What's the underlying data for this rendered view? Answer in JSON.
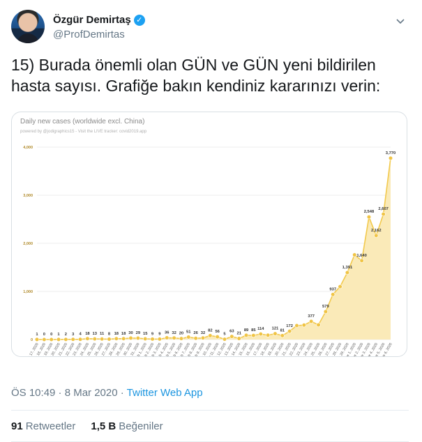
{
  "author": {
    "name": "Özgür Demirtaş",
    "handle": "@ProfDemirtas",
    "verified": true
  },
  "tweet_text": "15) Burada önemli olan GÜN ve GÜN yeni bildirilen hasta sayısı. Grafiğe bakın kendiniz kararınızı verin:",
  "timestamp": "ÖS 10:49 · 8 Mar 2020 ·",
  "source": "Twitter Web App",
  "stats": {
    "retweets": "91",
    "retweets_label": "Retweetler",
    "likes": "1,5 B",
    "likes_label": "Beğeniler"
  },
  "icons": {
    "verified": "verified-badge-icon",
    "caret": "chevron-down-icon"
  },
  "colors": {
    "accent": "#1da1f2",
    "series": "#f2c94c",
    "fill": "#faeab8"
  },
  "chart_data": {
    "type": "area",
    "title": "Daily new cases (worldwide excl. China)",
    "subtitle": "powered by @jodigraphics15 - Visit the LIVE tracker: covid2019.app",
    "ylim": [
      0,
      4000
    ],
    "yticks": [
      "4,000",
      "3,000",
      "2,000",
      "1,000",
      "0"
    ],
    "grid": true,
    "x": [
      "Jan 17, 2020",
      "Jan 18, 2020",
      "Jan 19, 2020",
      "Jan 20, 2020",
      "Jan 21, 2020",
      "Jan 22, 2020",
      "Jan 23, 2020",
      "Jan 24, 2020",
      "Jan 25, 2020",
      "Jan 26, 2020",
      "Jan 27, 2020",
      "Jan 28, 2020",
      "Jan 29, 2020",
      "Jan 30, 2020",
      "Jan 31, 2020",
      "Feb 1, 2020",
      "Feb 2, 2020",
      "Feb 3, 2020",
      "Feb 4, 2020",
      "Feb 5, 2020",
      "Feb 6, 2020",
      "Feb 7, 2020",
      "Feb 8, 2020",
      "Feb 9, 2020",
      "Feb 10, 2020",
      "Feb 11, 2020",
      "Feb 12, 2020",
      "Feb 13, 2020",
      "Feb 14, 2020",
      "Feb 15, 2020",
      "Feb 16, 2020",
      "Feb 17, 2020",
      "Feb 18, 2020",
      "Feb 19, 2020",
      "Feb 20, 2020",
      "Feb 21, 2020",
      "Feb 22, 2020",
      "Feb 23, 2020",
      "Feb 24, 2020",
      "Feb 25, 2020",
      "Feb 26, 2020",
      "Feb 27, 2020",
      "Feb 28, 2020",
      "Feb 29, 2020",
      "Mar 1, 2020",
      "Mar 2, 2020",
      "Mar 3, 2020",
      "Mar 4, 2020",
      "Mar 5, 2020",
      "Mar 6, 2020"
    ],
    "values": [
      1,
      0,
      0,
      1,
      2,
      3,
      4,
      18,
      13,
      11,
      8,
      18,
      18,
      30,
      29,
      15,
      9,
      9,
      36,
      32,
      20,
      51,
      26,
      32,
      82,
      56,
      5,
      63,
      21,
      89,
      85,
      114,
      90,
      121,
      81,
      172,
      290,
      300,
      377,
      305,
      579,
      937,
      1100,
      1391,
      1760,
      1640,
      2548,
      2162,
      2607,
      3770
    ],
    "labels": [
      "1",
      "0",
      "0",
      "1",
      "2",
      "3",
      "4",
      "18",
      "13",
      "11",
      "8",
      "18",
      "18",
      "30",
      "29",
      "15",
      "9",
      "9",
      "36",
      "32",
      "20",
      "51",
      "26",
      "32",
      "82",
      "56",
      "5",
      "63",
      "21",
      "89",
      "85",
      "114",
      "",
      "121",
      "81",
      "172",
      "",
      "",
      "377",
      "",
      "579",
      "937",
      "",
      "1,391",
      "",
      "1,640",
      "2,548",
      "2,162",
      "2,607",
      "3,770"
    ]
  }
}
